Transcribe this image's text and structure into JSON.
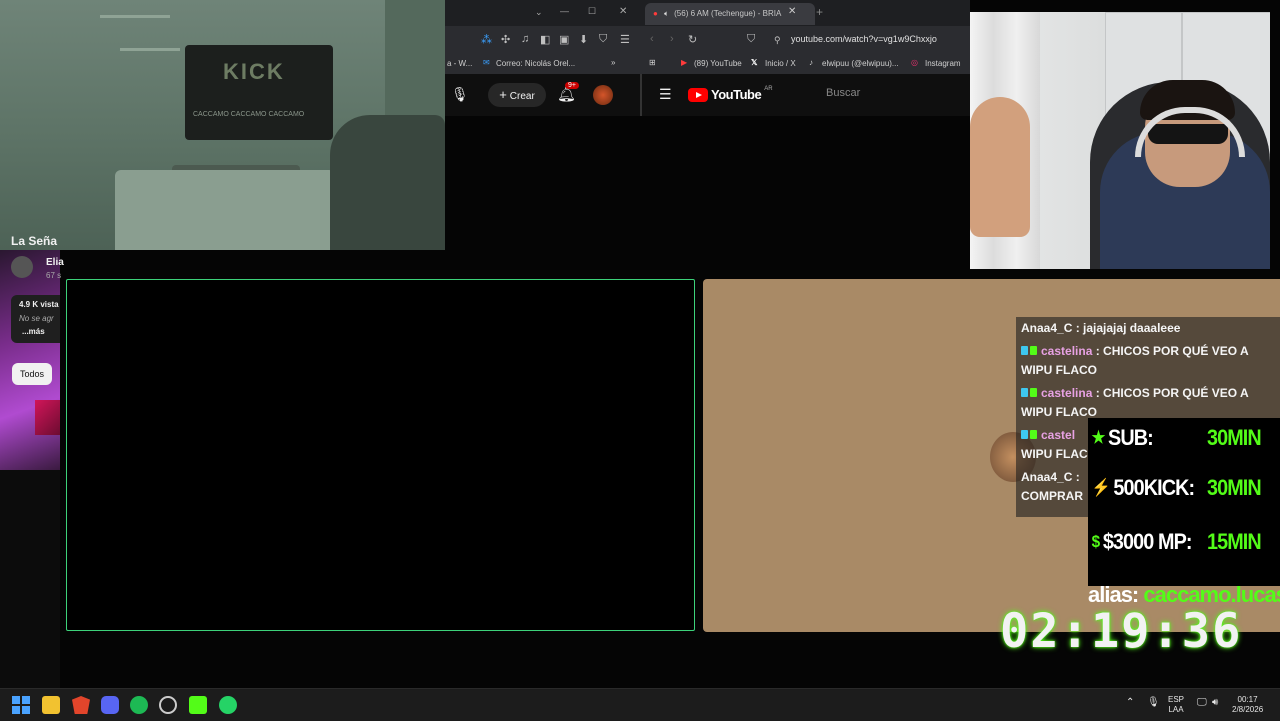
{
  "browser": {
    "tab_active_title": "(56) 6 AM (Techengue) - BRIA",
    "window_controls": [
      "⌄",
      "—",
      "☐",
      "✕"
    ],
    "url": "youtube.com/watch?v=vg1w9Chxxjo",
    "bookmarks": [
      "(89) YouTube",
      "Inicio / X",
      "elwipuu (@elwipuu)...",
      "Instagram"
    ],
    "left_bookmarks": [
      "a - W...",
      "Correo: Nicolás Orel..."
    ],
    "more_bookmarks": "»"
  },
  "youtube": {
    "create_label": "Crear",
    "notif_badge": "9+",
    "logo_text": "YouTube",
    "logo_region": "AR",
    "search_placeholder": "Buscar"
  },
  "left_panel": {
    "video_title": "La Seña",
    "channel": "Elia",
    "subs": "67 s",
    "views": "4.9 K vista",
    "desc": "No se agr",
    "more": "...más",
    "chip": "Todos"
  },
  "cam_room": {
    "banner_text": "KICK",
    "banner_sub": "CACCAMO  CACCAMO  CACCAMO"
  },
  "chat": {
    "messages": [
      {
        "user": "Anaa4_C",
        "text": "jajajajaj daaaleee",
        "badges": false
      },
      {
        "user": "castelina",
        "text": "CHICOS POR QUÉ VEO A WIPU FLACO",
        "badges": true
      },
      {
        "user": "castelina",
        "text": "CHICOS POR QUÉ VEO A WIPU FLACO",
        "badges": true
      },
      {
        "user": "castel",
        "text": "WIPU FLACO",
        "badges": true
      },
      {
        "user": "Anaa4_C",
        "text": "COMPRAR",
        "badges": false
      }
    ]
  },
  "goals": [
    {
      "icon": "★",
      "label": "SUB:",
      "value": "30MIN"
    },
    {
      "icon": "⚡",
      "label": "500KICK:",
      "value": "30MIN"
    },
    {
      "icon": "$",
      "label": "$3000 MP:",
      "value": "15MIN"
    }
  ],
  "alias": {
    "label": "alias: ",
    "value": "caccamo.lucas"
  },
  "timer": "02:19:36",
  "taskbar": {
    "lang_top": "ESP",
    "lang_bottom": "LAA",
    "time": "00:17",
    "date": "2/8/2026"
  },
  "colors": {
    "kick_green": "#53fc18",
    "youtube_red": "#ff0000",
    "chat_panel": "#a98a66"
  }
}
